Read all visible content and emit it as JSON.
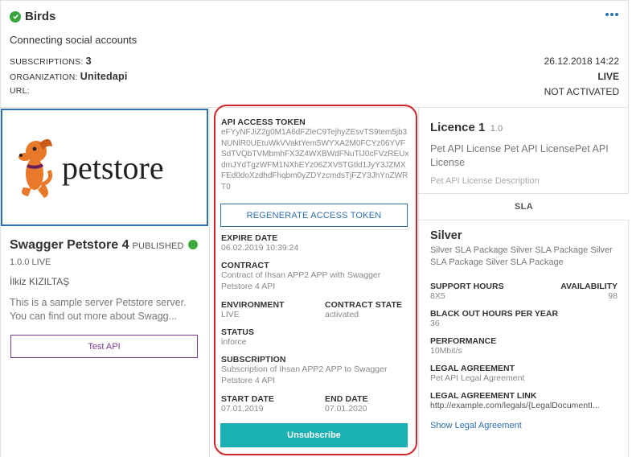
{
  "app": {
    "name": "Birds",
    "description": "Connecting social accounts",
    "subscriptions_label": "SUBSCRIPTIONS:",
    "subscriptions_count": "3",
    "organization_label": "ORGANIZATION:",
    "organization_name": "Unitedapi",
    "url_label": "URL:",
    "date": "26.12.2018 14:22",
    "environment": "LIVE",
    "status": "NOT ACTIVATED"
  },
  "api": {
    "name": "Swagger Petstore 4",
    "state": "PUBLISHED",
    "version": "1.0.0 LIVE",
    "owner": "İlkiz KIZILTAŞ",
    "description": "This is a sample server Petstore server. You can find out more about Swagg...",
    "test_button": "Test API",
    "logo_text": "petstore"
  },
  "subscription": {
    "token_label": "API ACCESS TOKEN",
    "token_value": "eFYyNFJiZ2g0M1A6dFZleC9TejhyZEsvTS9tem5jb3NUNlR0UEtuWkVVaktYem5WYXA2M0FCYz06YVFSdTVQbTVMbmhFX3Z4WXBWdFNuTlJ0cFVzREUxdmJYdTgzWFM1NXhEYz06ZXV5TGtld1JyY3JZMXFEd0doXzdhdFhqbm0yZDYzcmdsTjFZY3JhYnZWRT0",
    "regenerate_button": "REGENERATE ACCESS TOKEN",
    "expire_label": "EXPIRE DATE",
    "expire_value": "06.02.2019 10:39:24",
    "contract_label": "CONTRACT",
    "contract_value": "Contract of Ihsan APP2 APP with Swagger Petstore 4 API",
    "environment_label": "ENVIRONMENT",
    "environment_value": "LIVE",
    "contract_state_label": "CONTRACT STATE",
    "contract_state_value": "activated",
    "status_label": "STATUS",
    "status_value": "inforce",
    "subscription_label": "SUBSCRIPTION",
    "subscription_value": "Subscription of Ihsan APP2 APP to Swagger Petstore 4 API",
    "start_label": "START DATE",
    "start_value": "07.01.2019",
    "end_label": "END DATE",
    "end_value": "07.01.2020",
    "unsubscribe_button": "Unsubscribe"
  },
  "licence": {
    "title": "Licence 1",
    "version": "1.0",
    "name": "Pet API License Pet API LicensePet API License",
    "description": "Pet API License Description",
    "sla_tab": "SLA",
    "sla_title": "Silver",
    "sla_description": "Silver SLA Package Silver SLA Package Silver SLA Package Silver SLA Package",
    "support_label": "SUPPORT HOURS",
    "support_value": "8X5",
    "availability_label": "AVAILABILITY",
    "availability_value": "98",
    "blackout_label": "BLACK OUT HOURS PER YEAR",
    "blackout_value": "36",
    "performance_label": "PERFORMANCE",
    "performance_value": "10Mbit/s",
    "legal_label": "LEGAL AGREEMENT",
    "legal_value": "Pet API Legal Agreement",
    "legal_link_label": "LEGAL AGREEMENT LINK",
    "legal_link_value": "http://example.com/legals/{LegalDocumentI...",
    "show_legal": "Show Legal Agreement"
  },
  "colors": {
    "accent_blue": "#2f6fb0",
    "highlight_red": "#d3252c",
    "unsubscribe_teal": "#1bb1b4",
    "published_green": "#3caa3c",
    "test_purple": "#7a3b8f"
  },
  "icons": [
    "check-circle-icon",
    "more-dots-icon",
    "published-dot-icon",
    "petstore-dog-logo"
  ]
}
